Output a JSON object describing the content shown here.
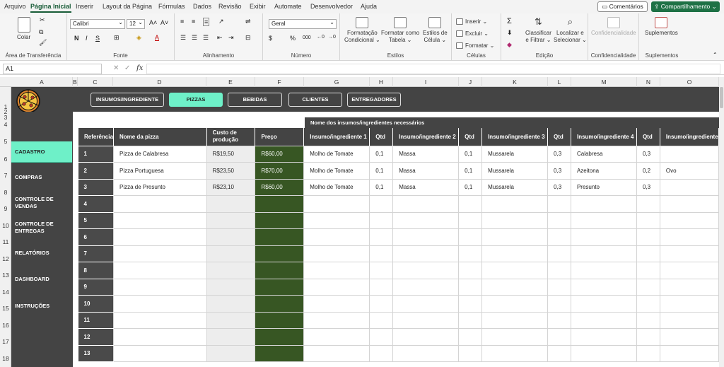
{
  "menu": {
    "tabs": [
      "Arquivo",
      "Página Inicial",
      "Inserir",
      "Layout da Página",
      "Fórmulas",
      "Dados",
      "Revisão",
      "Exibir",
      "Automate",
      "Desenvolvedor",
      "Ajuda"
    ],
    "active_index": 1,
    "comments": "Comentários",
    "share": "Compartilhamento"
  },
  "ribbon": {
    "clipboard": {
      "label": "Área de Transferência",
      "paste": "Colar"
    },
    "font": {
      "label": "Fonte",
      "name": "Calibri",
      "size": "12",
      "bold": "N",
      "italic": "I",
      "underline": "S",
      "grow": "A˄",
      "shrink": "A˅"
    },
    "alignment": {
      "label": "Alinhamento"
    },
    "number": {
      "label": "Número",
      "format": "Geral",
      "percent": "%",
      "thousands": "000"
    },
    "styles": {
      "label": "Estilos",
      "conditional": [
        "Formatação",
        "Condicional ⌄"
      ],
      "table": [
        "Formatar como",
        "Tabela ⌄"
      ],
      "cell": [
        "Estilos de",
        "Célula ⌄"
      ]
    },
    "cells": {
      "label": "Células",
      "insert": "Inserir",
      "delete": "Excluir",
      "format": "Formatar"
    },
    "editing": {
      "label": "Edição",
      "sort": [
        "Classificar",
        "e Filtrar ⌄"
      ],
      "find": [
        "Localizar e",
        "Selecionar ⌄"
      ]
    },
    "sensitivity": {
      "label": "Confidencialidade",
      "button": "Confidencialidade"
    },
    "addins": {
      "label": "Suplementos",
      "button": "Suplementos"
    }
  },
  "formula_bar": {
    "namebox": "A1",
    "fx": "fx",
    "formula": ""
  },
  "columns": [
    "A",
    "B",
    "C",
    "D",
    "E",
    "F",
    "G",
    "H",
    "I",
    "J",
    "K",
    "L",
    "M",
    "N",
    "O"
  ],
  "rows": [
    "1",
    "2",
    "3",
    "4",
    "5",
    "6",
    "7",
    "8",
    "9",
    "10",
    "11",
    "12",
    "13",
    "14",
    "15",
    "16",
    "17",
    "18"
  ],
  "nav": [
    "INSUMOS/INGREDIENTE",
    "PIZZAS",
    "BEBIDAS",
    "CLIENTES",
    "ENTREGADORES"
  ],
  "nav_active": 1,
  "sidebar": [
    "CADASTRO",
    "COMPRAS",
    "CONTROLE DE VENDAS",
    "CONTROLE DE ENTREGAS",
    "RELATÓRIOS",
    "DASHBOARD",
    "INSTRUÇÕES"
  ],
  "sidebar_active": 0,
  "table": {
    "supergroup": "Nome dos insumos/ingredientes necessários",
    "headers": [
      "Referência",
      "Nome da pizza",
      "Custo de produção",
      "Preço",
      "Insumo/ingrediente 1",
      "Qtd",
      "Insumo/ingrediente 2",
      "Qtd",
      "Insumo/ingrediente 3",
      "Qtd",
      "Insumo/ingrediente 4",
      "Qtd",
      "Insumo/ingrediente"
    ],
    "rows": [
      [
        "1",
        "Pizza de Calabresa",
        "R$19,50",
        "R$60,00",
        "Molho de Tomate",
        "0,1",
        "Massa",
        "0,1",
        "Mussarela",
        "0,3",
        "Calabresa",
        "0,3",
        ""
      ],
      [
        "2",
        "Pizza Portuguesa",
        "R$23,50",
        "R$70,00",
        "Molho de Tomate",
        "0,1",
        "Massa",
        "0,1",
        "Mussarela",
        "0,3",
        "Azeitona",
        "0,2",
        "Ovo"
      ],
      [
        "3",
        "Pizza de Presunto",
        "R$23,10",
        "R$60,00",
        "Molho de Tomate",
        "0,1",
        "Massa",
        "0,1",
        "Mussarela",
        "0,3",
        "Presunto",
        "0,3",
        ""
      ],
      [
        "4",
        "",
        "",
        "",
        "",
        "",
        "",
        "",
        "",
        "",
        "",
        "",
        ""
      ],
      [
        "5",
        "",
        "",
        "",
        "",
        "",
        "",
        "",
        "",
        "",
        "",
        "",
        ""
      ],
      [
        "6",
        "",
        "",
        "",
        "",
        "",
        "",
        "",
        "",
        "",
        "",
        "",
        ""
      ],
      [
        "7",
        "",
        "",
        "",
        "",
        "",
        "",
        "",
        "",
        "",
        "",
        "",
        ""
      ],
      [
        "8",
        "",
        "",
        "",
        "",
        "",
        "",
        "",
        "",
        "",
        "",
        "",
        ""
      ],
      [
        "9",
        "",
        "",
        "",
        "",
        "",
        "",
        "",
        "",
        "",
        "",
        "",
        ""
      ],
      [
        "10",
        "",
        "",
        "",
        "",
        "",
        "",
        "",
        "",
        "",
        "",
        "",
        ""
      ],
      [
        "11",
        "",
        "",
        "",
        "",
        "",
        "",
        "",
        "",
        "",
        "",
        "",
        ""
      ],
      [
        "12",
        "",
        "",
        "",
        "",
        "",
        "",
        "",
        "",
        "",
        "",
        "",
        ""
      ],
      [
        "13",
        "",
        "",
        "",
        "",
        "",
        "",
        "",
        "",
        "",
        "",
        "",
        ""
      ]
    ]
  },
  "colors": {
    "accent": "#6ef0c8",
    "dark": "#444444",
    "price": "#375623",
    "brand": "#1e7145"
  }
}
